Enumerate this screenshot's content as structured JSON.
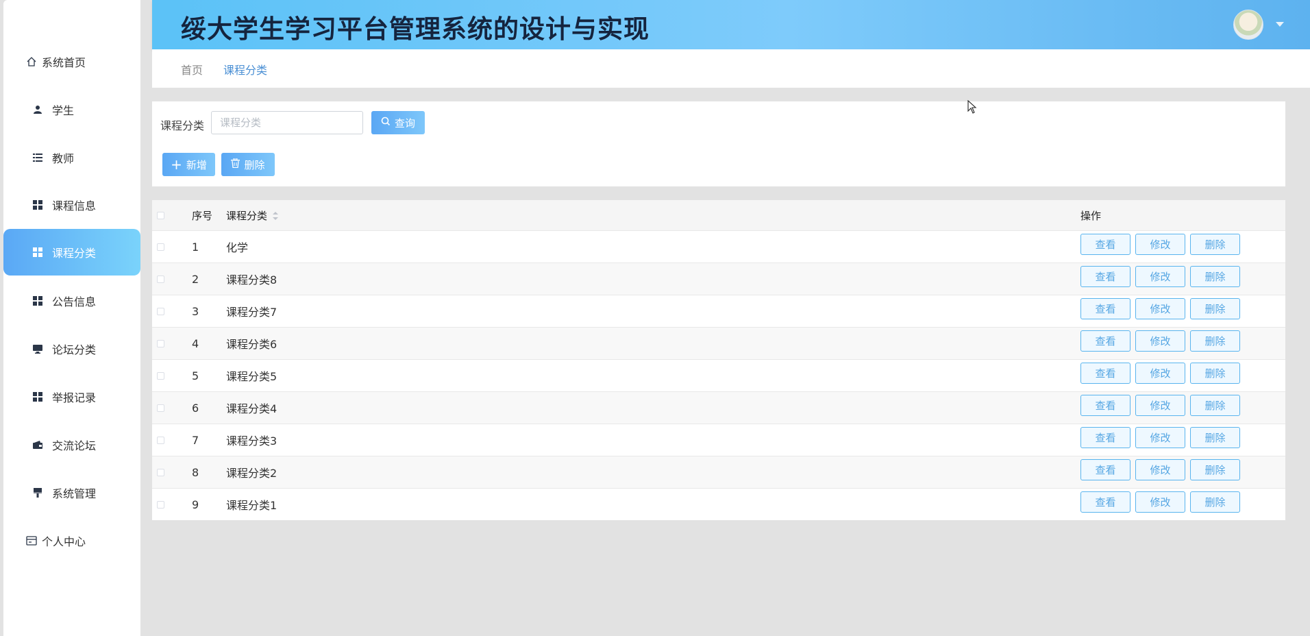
{
  "header": {
    "title": "绥大学生学习平台管理系统的设计与实现"
  },
  "sidebar": {
    "items": [
      {
        "label": "系统首页",
        "icon": "home-icon"
      },
      {
        "label": "学生",
        "icon": "user-icon"
      },
      {
        "label": "教师",
        "icon": "list-icon"
      },
      {
        "label": "课程信息",
        "icon": "grid-icon"
      },
      {
        "label": "课程分类",
        "icon": "grid-icon",
        "active": true
      },
      {
        "label": "公告信息",
        "icon": "grid-icon"
      },
      {
        "label": "论坛分类",
        "icon": "monitor-icon"
      },
      {
        "label": "举报记录",
        "icon": "grid-icon"
      },
      {
        "label": "交流论坛",
        "icon": "wallet-icon"
      },
      {
        "label": "系统管理",
        "icon": "brush-icon"
      },
      {
        "label": "个人中心",
        "icon": "card-icon"
      }
    ]
  },
  "breadcrumb": {
    "home": "首页",
    "current": "课程分类"
  },
  "search": {
    "label": "课程分类",
    "placeholder": "课程分类",
    "value": "",
    "query_label": "查询",
    "add_label": "新增",
    "delete_label": "删除"
  },
  "table": {
    "headers": {
      "index": "序号",
      "name": "课程分类",
      "actions": "操作"
    },
    "actions": {
      "view": "查看",
      "edit": "修改",
      "delete": "删除"
    },
    "rows": [
      {
        "index": "1",
        "name": "化学"
      },
      {
        "index": "2",
        "name": "课程分类8"
      },
      {
        "index": "3",
        "name": "课程分类7"
      },
      {
        "index": "4",
        "name": "课程分类6"
      },
      {
        "index": "5",
        "name": "课程分类5"
      },
      {
        "index": "6",
        "name": "课程分类4"
      },
      {
        "index": "7",
        "name": "课程分类3"
      },
      {
        "index": "8",
        "name": "课程分类2"
      },
      {
        "index": "9",
        "name": "课程分类1"
      }
    ]
  },
  "colors": {
    "accent": "#5aa7f4",
    "header_gradient_end": "#7ecbfb",
    "title": "#15243e"
  }
}
